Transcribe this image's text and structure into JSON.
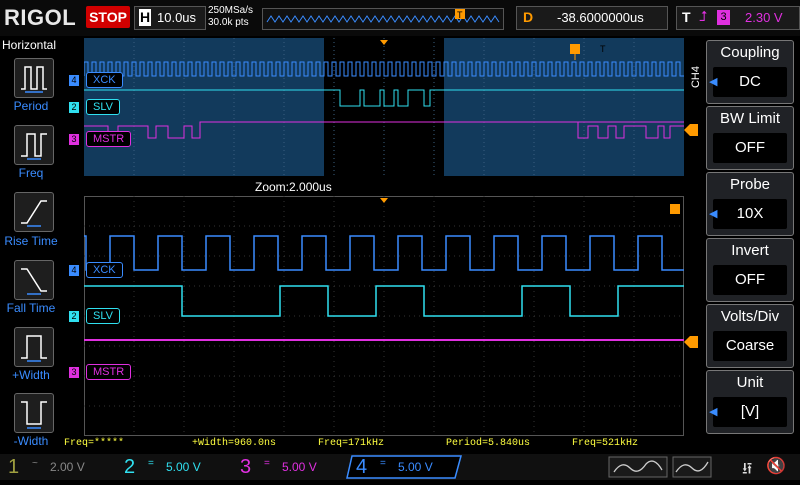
{
  "topbar": {
    "logo": "RIGOL",
    "run_state": "STOP",
    "timebase_letter": "H",
    "timebase": "10.0us",
    "sample_rate": "250MSa/s",
    "memory_depth": "30.0k pts",
    "delay_letter": "D",
    "delay": "-38.6000000us",
    "trigger_letter": "T",
    "trigger_source": "3",
    "trigger_level": "2.30 V"
  },
  "left_menu": {
    "title": "Horizontal",
    "items": [
      {
        "label": "Period",
        "icon": "period-icon"
      },
      {
        "label": "Freq",
        "icon": "freq-icon"
      },
      {
        "label": "Rise Time",
        "icon": "rise-time-icon"
      },
      {
        "label": "Fall Time",
        "icon": "fall-time-icon"
      },
      {
        "label": "+Width",
        "icon": "positive-width-icon"
      },
      {
        "label": "-Width",
        "icon": "negative-width-icon"
      }
    ]
  },
  "right_menu": {
    "channel_tag": "CH4",
    "items": [
      {
        "title": "Coupling",
        "value": "DC"
      },
      {
        "title": "BW Limit",
        "value": "OFF"
      },
      {
        "title": "Probe",
        "value": "10X"
      },
      {
        "title": "Invert",
        "value": "OFF"
      },
      {
        "title": "Volts/Div",
        "value": "Coarse"
      },
      {
        "title": "Unit",
        "value": "[V]"
      }
    ]
  },
  "waveform": {
    "zoom_label": "Zoom:2.000us",
    "channels": [
      {
        "num": "4",
        "name": "XCK",
        "color": "#3a8cff"
      },
      {
        "num": "2",
        "name": "SLV",
        "color": "#30e0f0"
      },
      {
        "num": "3",
        "name": "MSTR",
        "color": "#e030e0"
      }
    ],
    "trigger_marker": "T"
  },
  "measurements": [
    {
      "text": "Freq=*****"
    },
    {
      "text": "+Width=960.0ns"
    },
    {
      "text": "Freq=171kHz"
    },
    {
      "text": "Period=5.840us"
    },
    {
      "text": "Freq=521kHz"
    }
  ],
  "bottom": {
    "channels": [
      {
        "num": "1",
        "coupling": "~",
        "scale": "2.00 V",
        "color": "#a0a040"
      },
      {
        "num": "2",
        "coupling": "=",
        "scale": "5.00 V",
        "color": "#30e0f0"
      },
      {
        "num": "3",
        "coupling": "=",
        "scale": "5.00 V",
        "color": "#e030e0"
      },
      {
        "num": "4",
        "coupling": "=",
        "scale": "5.00 V",
        "color": "#3a8cff"
      }
    ]
  },
  "colors": {
    "ch4": "#3a8cff",
    "ch2": "#30e0f0",
    "ch3": "#e030e0",
    "trigger": "#ff9a00",
    "stop": "#d10000"
  }
}
